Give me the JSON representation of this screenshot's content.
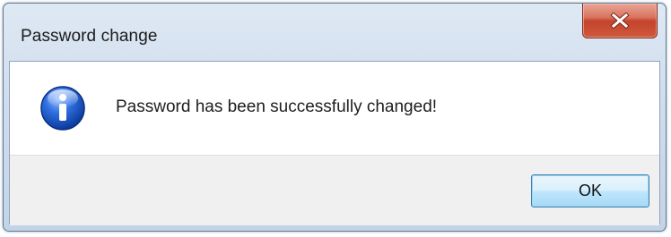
{
  "window": {
    "title": "Password change",
    "close_label": "x"
  },
  "dialog": {
    "icon": "information-icon",
    "message": "Password has been successfully changed!",
    "ok_label": "OK"
  },
  "colors": {
    "close_button": "#c4432c",
    "ok_button_border": "#3c7fb1",
    "info_icon_blue": "#1b5ad6"
  }
}
